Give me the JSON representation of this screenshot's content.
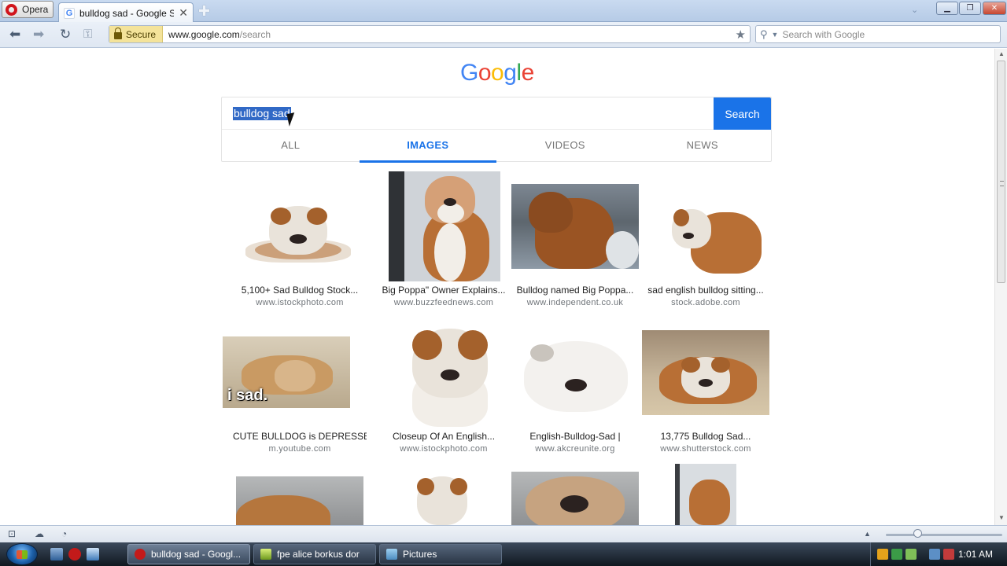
{
  "browser": {
    "menu_label": "Opera",
    "tab_title": "bulldog sad - Google S...",
    "secure_label": "Secure",
    "url_domain": "www.google.com",
    "url_path": "/search",
    "search_placeholder": "Search with Google"
  },
  "page": {
    "logo": [
      "G",
      "o",
      "o",
      "g",
      "l",
      "e"
    ],
    "query": "bulldog sad",
    "search_button": "Search",
    "tabs": [
      {
        "label": "ALL",
        "active": false
      },
      {
        "label": "IMAGES",
        "active": true
      },
      {
        "label": "VIDEOS",
        "active": false
      },
      {
        "label": "NEWS",
        "active": false
      }
    ],
    "results": [
      {
        "title": "5,100+ Sad Bulldog Stock...",
        "source": "www.istockphoto.com"
      },
      {
        "title": "Big Poppa\" Owner Explains...",
        "source": "www.buzzfeednews.com"
      },
      {
        "title": "Bulldog named Big Poppa...",
        "source": "www.independent.co.uk"
      },
      {
        "title": "sad english bulldog sitting...",
        "source": "stock.adobe.com"
      },
      {
        "title": "CUTE BULLDOG is DEPRESSED!...",
        "source": "m.youtube.com"
      },
      {
        "title": "Closeup Of An English...",
        "source": "www.istockphoto.com"
      },
      {
        "title": "English-Bulldog-Sad |",
        "source": "www.akcreunite.org"
      },
      {
        "title": "13,775 Bulldog Sad...",
        "source": "www.shutterstock.com"
      }
    ],
    "meme_caption": "i sad."
  },
  "taskbar": {
    "tasks": [
      "bulldog sad - Googl...",
      "fpe alice borkus dor",
      "Pictures"
    ],
    "clock": "1:01 AM"
  },
  "colors": {
    "google_blue": "#4285f4",
    "google_red": "#ea4335",
    "google_yellow": "#fbbc05",
    "google_green": "#34a853",
    "search_button": "#1a73e8",
    "selection": "#3169c6"
  },
  "icons": [
    "opera-logo-icon",
    "google-favicon-icon",
    "close-icon",
    "plus-icon",
    "back-icon",
    "forward-icon",
    "reload-icon",
    "key-icon",
    "lock-icon",
    "star-icon",
    "search-icon",
    "windows-start-icon"
  ]
}
